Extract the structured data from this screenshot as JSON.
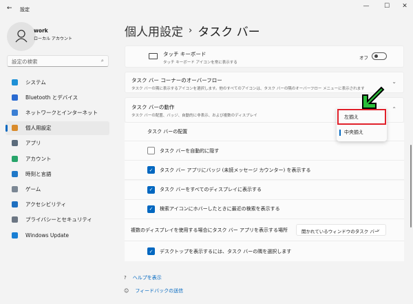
{
  "window": {
    "title": "設定",
    "back_icon": "←",
    "minimize": "—",
    "maximize": "☐",
    "close": "✕"
  },
  "user": {
    "name": "work",
    "account_type": "ローカル アカウント"
  },
  "search": {
    "placeholder": "設定の検索"
  },
  "nav": [
    {
      "label": "システム",
      "color": "#1e90d6"
    },
    {
      "label": "Bluetooth とデバイス",
      "color": "#2a6bd1"
    },
    {
      "label": "ネットワークとインターネット",
      "color": "#3b7fd4"
    },
    {
      "label": "個人用設定",
      "color": "#d98b2b",
      "selected": true
    },
    {
      "label": "アプリ",
      "color": "#5b6b7b"
    },
    {
      "label": "アカウント",
      "color": "#27a46a"
    },
    {
      "label": "時刻と言語",
      "color": "#1f78c8"
    },
    {
      "label": "ゲーム",
      "color": "#7b8794"
    },
    {
      "label": "アクセシビリティ",
      "color": "#1e6fc0"
    },
    {
      "label": "プライバシーとセキュリティ",
      "color": "#6c7683"
    },
    {
      "label": "Windows Update",
      "color": "#1a7fd4"
    }
  ],
  "header": {
    "parent": "個人用設定",
    "separator": "›",
    "current": "タスク バー"
  },
  "touch_keyboard": {
    "title": "タッチ キーボード",
    "desc": "タッチ キーボード アイコンを常に表示する",
    "state": "オフ"
  },
  "overflow": {
    "title": "タスク バー コーナーのオーバーフロー",
    "desc": "タスク バーの隅に表示するアイコンを選択します。他のすべてのアイコンは、タスク バーの隅のオーバーフロー メニューに表示されます"
  },
  "behavior": {
    "title": "タスク バーの動作",
    "desc": "タスク バーの配置、バッジ、自動的に非表示、および複数のディスプレイ",
    "alignment_label": "タスク バーの配置",
    "alignment_options": [
      "左揃え",
      "中央揃え"
    ],
    "alignment_selected": "中央揃え",
    "checks": [
      {
        "label": "タスク バーを自動的に隠す",
        "checked": false
      },
      {
        "label": "タスク バー アプリにバッジ (未読メッセージ カウンター) を表示する",
        "checked": true
      },
      {
        "label": "タスク バーをすべてのディスプレイに表示する",
        "checked": true
      },
      {
        "label": "検索アイコンにホバーしたときに最近の検索を表示する",
        "checked": true
      }
    ],
    "multi_display_label": "複数のディスプレイを使用する場合にタスク バー アプリを表示する場所",
    "multi_display_value": "開かれているウィンドウのタスク バー",
    "desktop_check": {
      "label": "デスクトップを表示するには、タスク バーの隅を選択します",
      "checked": true
    }
  },
  "links": {
    "help": "ヘルプを表示",
    "feedback": "フィードバックの送信"
  }
}
